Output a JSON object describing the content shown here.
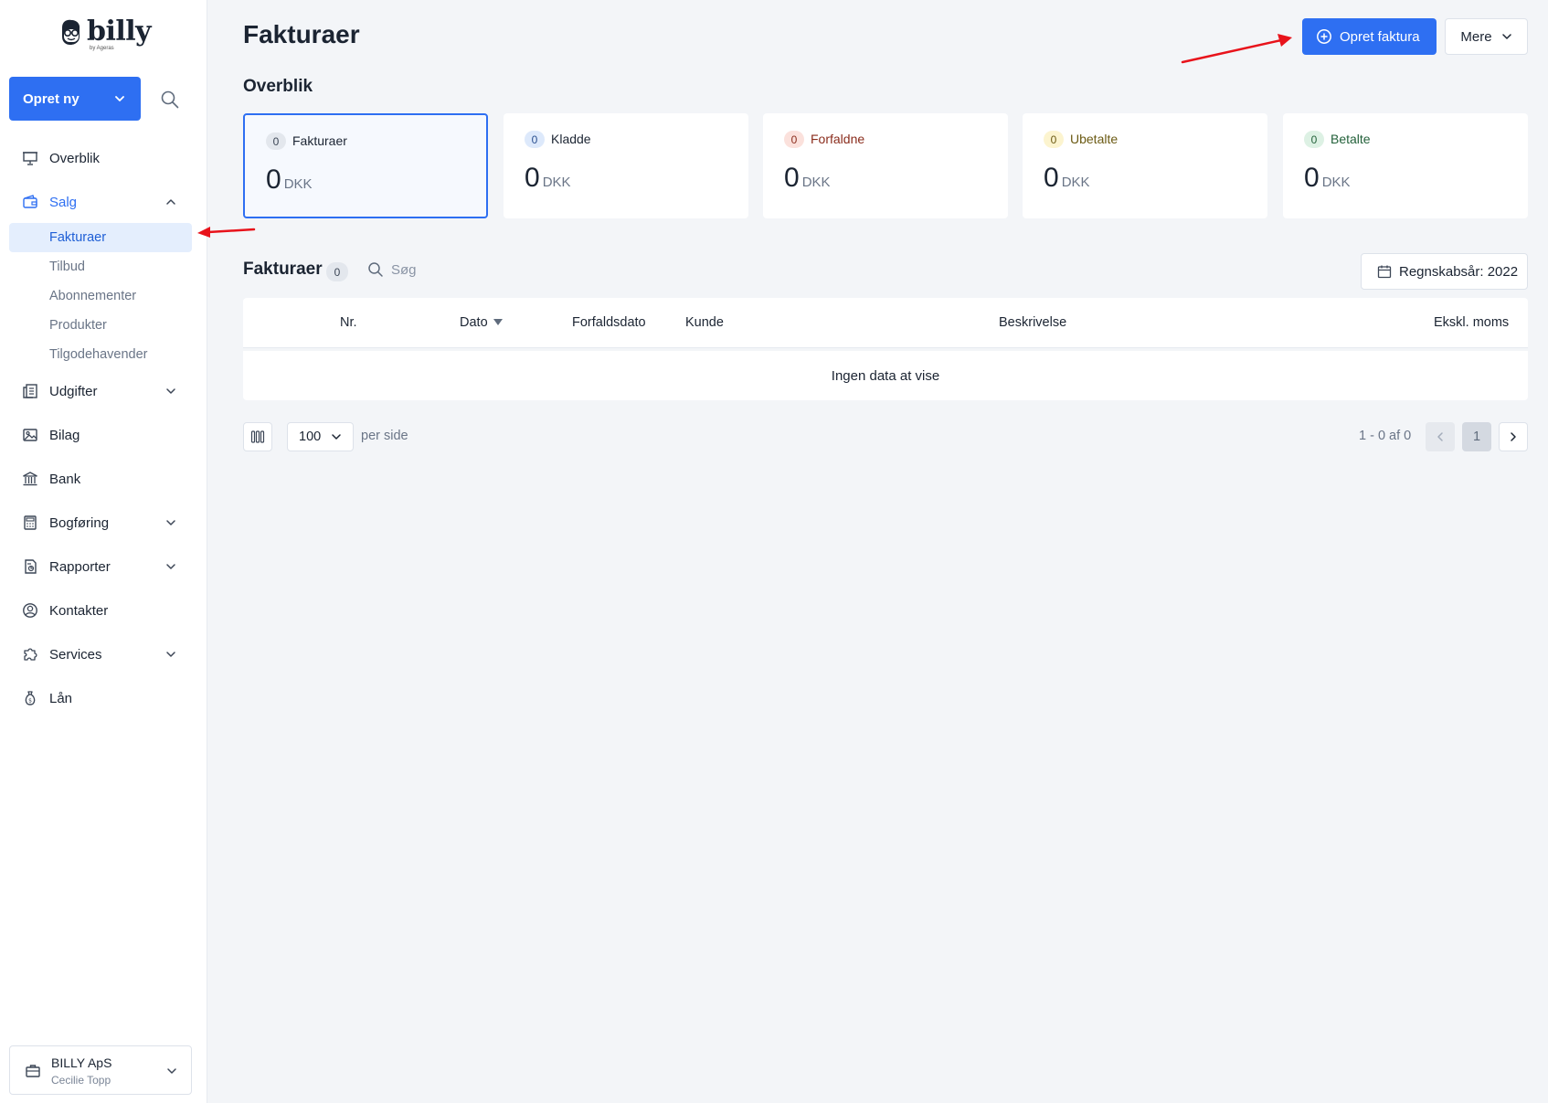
{
  "brand": {
    "name": "billy",
    "sub": "by Ageras"
  },
  "sidebar": {
    "create_label": "Opret ny",
    "items": [
      {
        "label": "Overblik",
        "icon": "presentation-icon",
        "chevron": false
      },
      {
        "label": "Salg",
        "icon": "wallet-icon",
        "chevron": "up",
        "active": true
      },
      {
        "label": "Udgifter",
        "icon": "receipts-icon",
        "chevron": "down"
      },
      {
        "label": "Bilag",
        "icon": "image-icon",
        "chevron": false
      },
      {
        "label": "Bank",
        "icon": "bank-icon",
        "chevron": false
      },
      {
        "label": "Bogføring",
        "icon": "calculator-icon",
        "chevron": "down"
      },
      {
        "label": "Rapporter",
        "icon": "report-icon",
        "chevron": "down"
      },
      {
        "label": "Kontakter",
        "icon": "user-circle-icon",
        "chevron": false
      },
      {
        "label": "Services",
        "icon": "puzzle-icon",
        "chevron": "down"
      },
      {
        "label": "Lån",
        "icon": "money-bag-icon",
        "chevron": false
      }
    ],
    "sub_items": [
      "Fakturaer",
      "Tilbud",
      "Abonnementer",
      "Produkter",
      "Tilgodehavender"
    ],
    "org": {
      "name": "BILLY ApS",
      "user": "Cecilie Topp"
    }
  },
  "header": {
    "title": "Fakturaer",
    "primary_label": "Opret faktura",
    "more_label": "Mere"
  },
  "overview": {
    "title": "Overblik",
    "cards": [
      {
        "count": "0",
        "label": "Fakturaer",
        "amount": "0",
        "currency": "DKK",
        "badge_bg": "#e3e7ed",
        "badge_fg": "#3c4656",
        "label_color": "#1b2432"
      },
      {
        "count": "0",
        "label": "Kladde",
        "amount": "0",
        "currency": "DKK",
        "badge_bg": "#dde9fb",
        "badge_fg": "#2a4f8f",
        "label_color": "#1b2432"
      },
      {
        "count": "0",
        "label": "Forfaldne",
        "amount": "0",
        "currency": "DKK",
        "badge_bg": "#fbe1dc",
        "badge_fg": "#8a2c1c",
        "label_color": "#8a2c1c"
      },
      {
        "count": "0",
        "label": "Ubetalte",
        "amount": "0",
        "currency": "DKK",
        "badge_bg": "#fcf4cf",
        "badge_fg": "#6b5a13",
        "label_color": "#6b5a13"
      },
      {
        "count": "0",
        "label": "Betalte",
        "amount": "0",
        "currency": "DKK",
        "badge_bg": "#ddf1e4",
        "badge_fg": "#23613a",
        "label_color": "#23613a"
      }
    ]
  },
  "list": {
    "title": "Fakturaer",
    "count": "0",
    "search_placeholder": "Søg",
    "fiscal_year": "Regnskabsår: 2022",
    "columns": [
      "Nr.",
      "Dato",
      "Forfaldsdato",
      "Kunde",
      "Beskrivelse",
      "Ekskl. moms"
    ],
    "sort_column": "Dato",
    "empty_text": "Ingen data at vise"
  },
  "pagination": {
    "per_page": "100",
    "per_page_label": "per side",
    "info": "1 - 0 af 0",
    "current_page": "1"
  },
  "colors": {
    "accent": "#2e6ff2",
    "annotation": "#e8131b"
  }
}
